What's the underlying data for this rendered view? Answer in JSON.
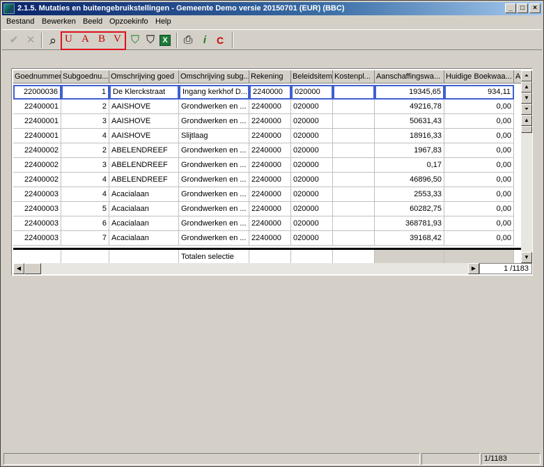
{
  "window": {
    "title": "2.1.5. Mutaties en buitengebruikstellingen - Gemeente Demo versie 20150701 (EUR) (BBC)",
    "buttons": [
      "_",
      "□",
      "×"
    ]
  },
  "menu": [
    "Bestand",
    "Bewerken",
    "Beeld",
    "Opzoekinfo",
    "Help"
  ],
  "toolbar": {
    "confirm": "✔",
    "cancel": "✕",
    "search": "⌕",
    "letters": [
      "U",
      "A",
      "B",
      "V"
    ],
    "filter_green": "⛉",
    "filter_empty": "⛉",
    "excel": "X",
    "print": "⎙",
    "person": "i",
    "c": "C"
  },
  "grid": {
    "columns": [
      "Goednummer",
      "Subgoednu...",
      "Omschrijving goed",
      "Omschrijving subg...",
      "Rekening",
      "Beleidsitem",
      "Kostenpl...",
      "Aanschaffingswa...",
      "Huidige Boekwaa...",
      "A"
    ],
    "rows": [
      [
        "22000036",
        "1",
        "De Klerckstraat",
        "Ingang kerkhof D...",
        "2240000",
        "020000",
        "",
        "19345,65",
        "934,11"
      ],
      [
        "22400001",
        "2",
        "AAISHOVE",
        "Grondwerken en ...",
        "2240000",
        "020000",
        "",
        "49216,78",
        "0,00"
      ],
      [
        "22400001",
        "3",
        "AAISHOVE",
        "Grondwerken en ...",
        "2240000",
        "020000",
        "",
        "50631,43",
        "0,00"
      ],
      [
        "22400001",
        "4",
        "AAISHOVE",
        "Slijtlaag",
        "2240000",
        "020000",
        "",
        "18916,33",
        "0,00"
      ],
      [
        "22400002",
        "2",
        "ABELENDREEF",
        "Grondwerken en ...",
        "2240000",
        "020000",
        "",
        "1967,83",
        "0,00"
      ],
      [
        "22400002",
        "3",
        "ABELENDREEF",
        "Grondwerken en ...",
        "2240000",
        "020000",
        "",
        "0,17",
        "0,00"
      ],
      [
        "22400002",
        "4",
        "ABELENDREEF",
        "Grondwerken en ...",
        "2240000",
        "020000",
        "",
        "46896,50",
        "0,00"
      ],
      [
        "22400003",
        "4",
        "Acacialaan",
        "Grondwerken en ...",
        "2240000",
        "020000",
        "",
        "2553,33",
        "0,00"
      ],
      [
        "22400003",
        "5",
        "Acacialaan",
        "Grondwerken en ...",
        "2240000",
        "020000",
        "",
        "60282,75",
        "0,00"
      ],
      [
        "22400003",
        "6",
        "Acacialaan",
        "Grondwerken en ...",
        "2240000",
        "020000",
        "",
        "368781,93",
        "0,00"
      ],
      [
        "22400003",
        "7",
        "Acacialaan",
        "Grondwerken en ...",
        "2240000",
        "020000",
        "",
        "39168,42",
        "0,00"
      ]
    ],
    "totals_label": "Totalen selectie",
    "record_counter": "1 /1183"
  },
  "status": {
    "record": "1/1183"
  }
}
